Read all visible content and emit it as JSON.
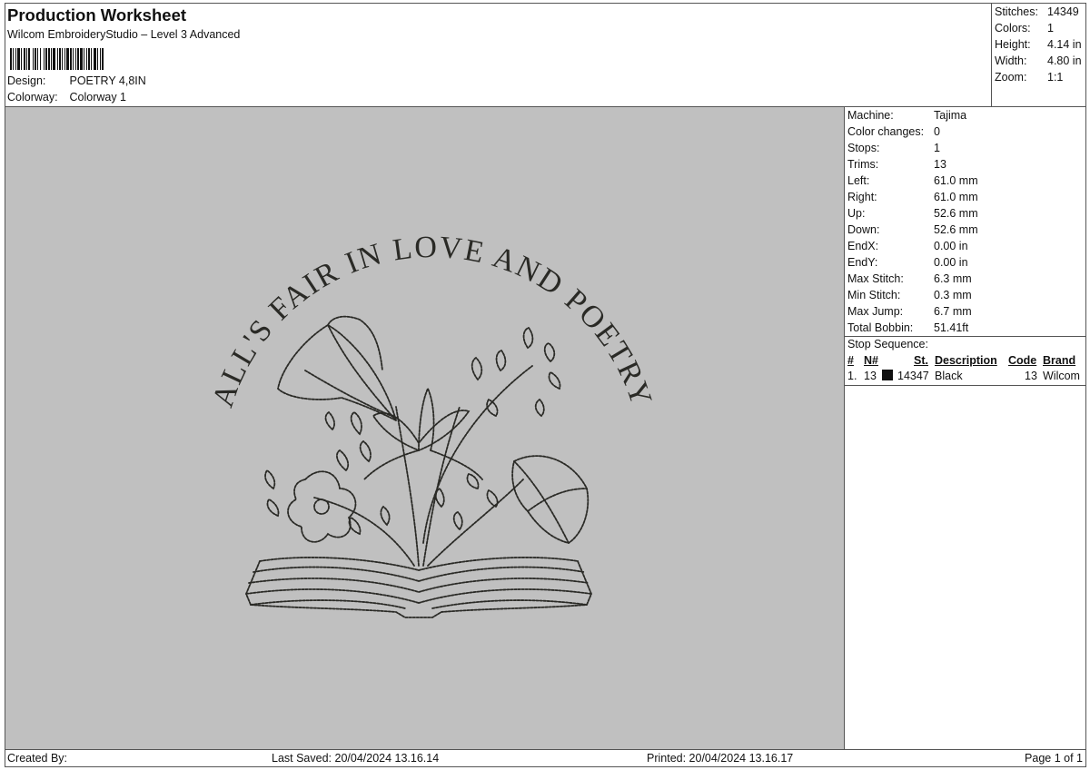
{
  "header": {
    "title": "Production Worksheet",
    "subtitle": "Wilcom EmbroideryStudio – Level 3 Advanced",
    "design_label": "Design:",
    "design_value": "POETRY 4,8IN",
    "colorway_label": "Colorway:",
    "colorway_value": "Colorway 1"
  },
  "stats": [
    {
      "label": "Stitches:",
      "value": "14349"
    },
    {
      "label": "Colors:",
      "value": "1"
    },
    {
      "label": "Height:",
      "value": "4.14 in"
    },
    {
      "label": "Width:",
      "value": "4.80 in"
    },
    {
      "label": "Zoom:",
      "value": "1:1"
    }
  ],
  "properties": [
    {
      "label": "Machine:",
      "value": "Tajima"
    },
    {
      "label": "Color changes:",
      "value": "0"
    },
    {
      "label": "Stops:",
      "value": "1"
    },
    {
      "label": "Trims:",
      "value": "13"
    },
    {
      "label": "Left:",
      "value": "61.0 mm"
    },
    {
      "label": "Right:",
      "value": "61.0 mm"
    },
    {
      "label": "Up:",
      "value": "52.6 mm"
    },
    {
      "label": "Down:",
      "value": "52.6 mm"
    },
    {
      "label": "EndX:",
      "value": "0.00 in"
    },
    {
      "label": "EndY:",
      "value": "0.00 in"
    },
    {
      "label": "Max Stitch:",
      "value": "6.3 mm"
    },
    {
      "label": "Min Stitch:",
      "value": "0.3 mm"
    },
    {
      "label": "Max Jump:",
      "value": "6.7 mm"
    },
    {
      "label": "Total Bobbin:",
      "value": "51.41ft"
    }
  ],
  "stop_sequence": {
    "title": "Stop Sequence:",
    "columns": [
      "#",
      "N#",
      "St.",
      "Description",
      "Code",
      "Brand"
    ],
    "rows": [
      {
        "index": "1.",
        "needle": "13",
        "stitches": "14347",
        "description": "Black",
        "code": "13",
        "brand": "Wilcom",
        "color": "#111111"
      }
    ]
  },
  "design": {
    "arc_text": "ALL'S FAIR IN LOVE AND POETRY",
    "thread_color": "#2a2a26",
    "background_color": "#c0c0c0"
  },
  "footer": {
    "created_by": "Created By:",
    "last_saved": "Last Saved: 20/04/2024 13.16.14",
    "printed": "Printed: 20/04/2024 13.16.17",
    "page": "Page 1 of 1"
  }
}
